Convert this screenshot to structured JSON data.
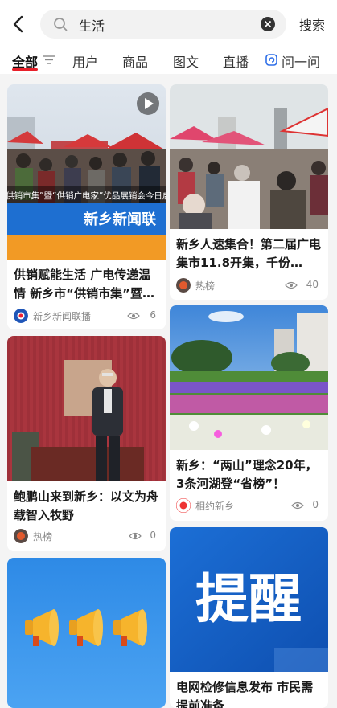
{
  "search": {
    "query": "生活",
    "button_label": "搜索"
  },
  "tabs": [
    {
      "label": "全部"
    },
    {
      "label": "用户"
    },
    {
      "label": "商品"
    },
    {
      "label": "图文"
    },
    {
      "label": "直播"
    },
    {
      "label": "问一问"
    }
  ],
  "cards": [
    {
      "title": "供销赋能生活 广电传递温情 新乡市“供销市集”暨…",
      "source": "新乡新闻联播",
      "views": "6",
      "image_caption": "“供销市集”暨“供销广电家”优品展销会今日启",
      "image_logo": "新乡新闻联"
    },
    {
      "title": "新乡人速集合！第二届广电集市11.8开集，千份…",
      "source": "热榜",
      "views": "40"
    },
    {
      "title": "鲍鹏山来到新乡：以文为舟 载智入牧野",
      "source": "热榜",
      "views": "0"
    },
    {
      "title": "新乡：“两山”理念20年，3条河湖登“省榜”！",
      "source": "相约新乡",
      "views": "0"
    },
    {
      "title": "",
      "source": "",
      "views": ""
    },
    {
      "title": "电网检修信息发布 市民需提前准备",
      "image_text": "提醒"
    }
  ],
  "colors": {
    "accent": "#e8202a",
    "ask_blue": "#2f6fe8"
  }
}
